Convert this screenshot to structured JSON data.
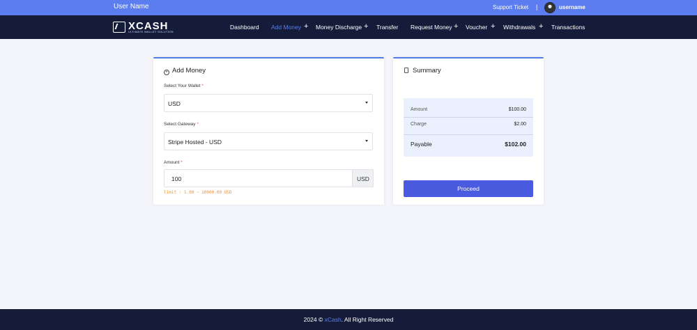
{
  "topbar": {
    "user_name": "User Name",
    "support_ticket": "Support Ticket",
    "separator": "|",
    "username": "username"
  },
  "brand": {
    "name": "XCASH",
    "tagline": "ULTIMATE WALLET SOLUTION"
  },
  "nav": {
    "items": [
      {
        "label": "Dashboard",
        "active": false,
        "has_submenu": false
      },
      {
        "label": "Add Money",
        "active": true,
        "has_submenu": true
      },
      {
        "label": "Money Discharge",
        "active": false,
        "has_submenu": true
      },
      {
        "label": "Transfer",
        "active": false,
        "has_submenu": false
      },
      {
        "label": "Request Money",
        "active": false,
        "has_submenu": true
      },
      {
        "label": "Voucher",
        "active": false,
        "has_submenu": true
      },
      {
        "label": "Withdrawals",
        "active": false,
        "has_submenu": true
      },
      {
        "label": "Transactions",
        "active": false,
        "has_submenu": false
      }
    ],
    "plus_symbol": "+"
  },
  "add_money": {
    "title": "Add Money",
    "wallet_label": "Select Your Wallet",
    "wallet_value": "USD",
    "gateway_label": "Select Gateway",
    "gateway_value": "Stripe Hosted - USD",
    "amount_label": "Amount",
    "amount_value": "100",
    "amount_currency": "USD",
    "limit_text": "limit : 1.00 ~ 10000.00 USD",
    "required_mark": "*"
  },
  "summary": {
    "title": "Summary",
    "rows": [
      {
        "label": "Amount",
        "value": "$100.00"
      },
      {
        "label": "Charge",
        "value": "$2.00"
      }
    ],
    "total": {
      "label": "Payable",
      "value": "$102.00"
    },
    "proceed_label": "Proceed"
  },
  "footer": {
    "prefix": "2024 © ",
    "brand": "xCash",
    "suffix": ". All Right Reserved"
  },
  "colors": {
    "topbar": "#5b7df0",
    "navbar": "#141c3a",
    "accent": "#4f7be8",
    "button": "#4a5be0",
    "limit": "#f0913a"
  }
}
